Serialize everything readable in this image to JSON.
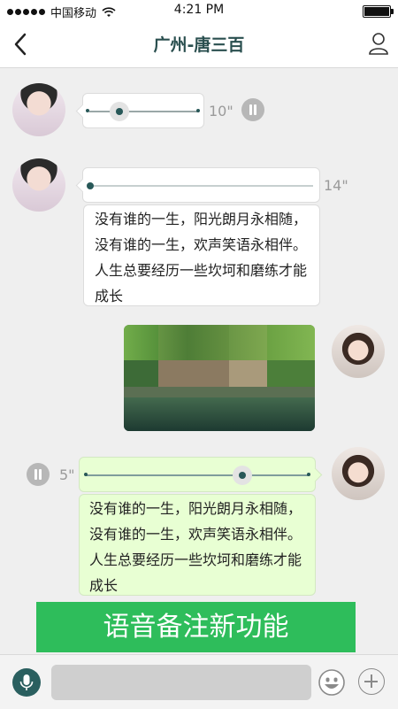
{
  "status_bar": {
    "carrier": "中国移动",
    "time": "4:21 PM"
  },
  "nav": {
    "title": "广州-唐三百"
  },
  "messages": [
    {
      "type": "voice",
      "side": "left",
      "duration": "10\"",
      "progress": 0.31,
      "playing": true
    },
    {
      "type": "voice",
      "side": "left",
      "duration": "14\"",
      "progress": 0.0,
      "playing": false
    },
    {
      "type": "text",
      "side": "left",
      "text": "没有谁的一生，阳光朗月永相随，没有谁的一生，欢声笑语永相伴。人生总要经历一些坎坷和磨练才能成长"
    },
    {
      "type": "image",
      "side": "right",
      "alt": "photo"
    },
    {
      "type": "voice",
      "side": "right",
      "duration": "5\"",
      "progress": 0.7,
      "playing": true
    },
    {
      "type": "text",
      "side": "right",
      "text": "没有谁的一生，阳光朗月永相随，没有谁的一生，欢声笑语永相伴。人生总要经历一些坎坷和磨练才能成长"
    }
  ],
  "banner": {
    "label": "语音备注新功能"
  },
  "input_bar": {
    "placeholder": ""
  },
  "colors": {
    "accent": "#285858",
    "banner": "#2ebd5b",
    "sent_bubble": "#e8ffd3"
  }
}
